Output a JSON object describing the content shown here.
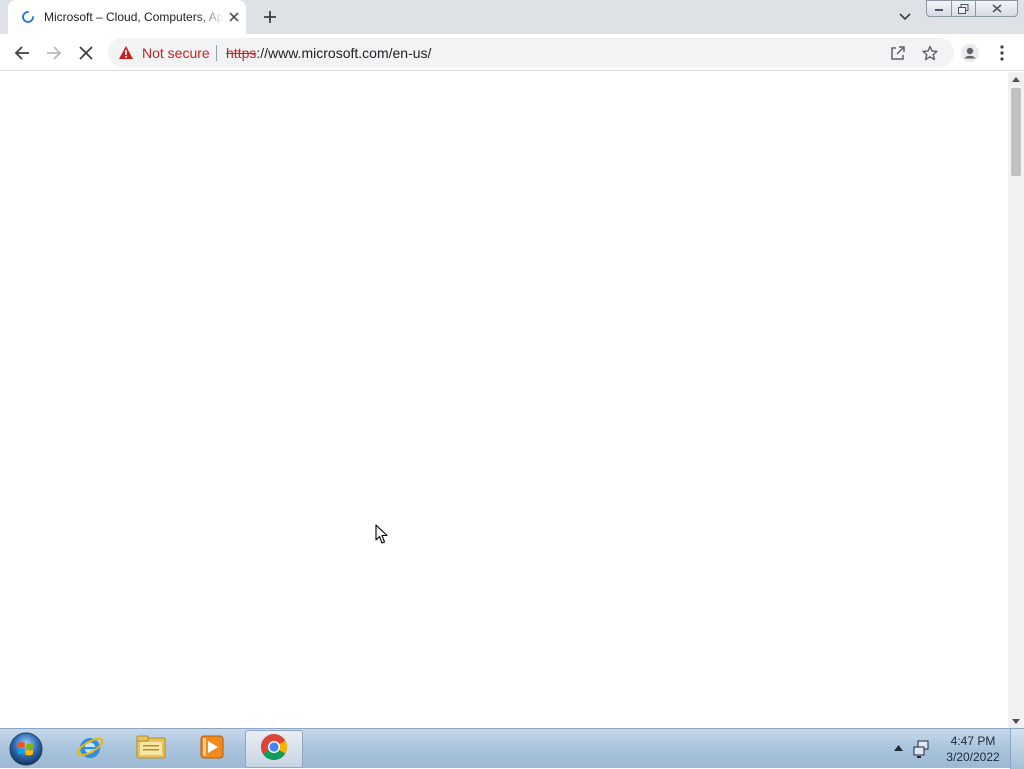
{
  "browser": {
    "tab": {
      "title": "Microsoft – Cloud, Computers, Apps & Gaming",
      "loading": true,
      "icons": {
        "spinner": "loading-spinner-icon",
        "close": "close-icon"
      }
    },
    "new_tab_icon": "plus-icon",
    "tab_search_icon": "chevron-down-icon",
    "window_controls": [
      "minimize-icon",
      "restore-icon",
      "close-icon"
    ]
  },
  "toolbar": {
    "icons": [
      "back-arrow-icon",
      "forward-arrow-icon",
      "stop-icon"
    ],
    "security": {
      "label": "Not secure",
      "icon": "warning-triangle-icon",
      "color": "#c5221f"
    },
    "url": {
      "scheme": "https",
      "rest": "://www.microsoft.com/en-us/"
    },
    "right_icons": [
      "share-icon",
      "bookmark-star-icon",
      "profile-icon",
      "menu-kebab-icon"
    ]
  },
  "page": {
    "background": "#ffffff",
    "state": "blank-loading"
  },
  "taskbar": {
    "apps": [
      {
        "name": "internet-explorer",
        "icon": "internet-explorer-icon",
        "active": false
      },
      {
        "name": "file-explorer",
        "icon": "folder-icon",
        "active": false
      },
      {
        "name": "media-player",
        "icon": "media-player-icon",
        "active": false
      },
      {
        "name": "chrome",
        "icon": "chrome-icon",
        "active": true
      }
    ],
    "clock": {
      "time": "4:47 PM",
      "date": "3/20/2022"
    }
  },
  "colors": {
    "accent": "#1a73e8",
    "tabstrip": "#dee1e6",
    "omnibox": "#f1f3f4",
    "warning": "#c5221f"
  }
}
